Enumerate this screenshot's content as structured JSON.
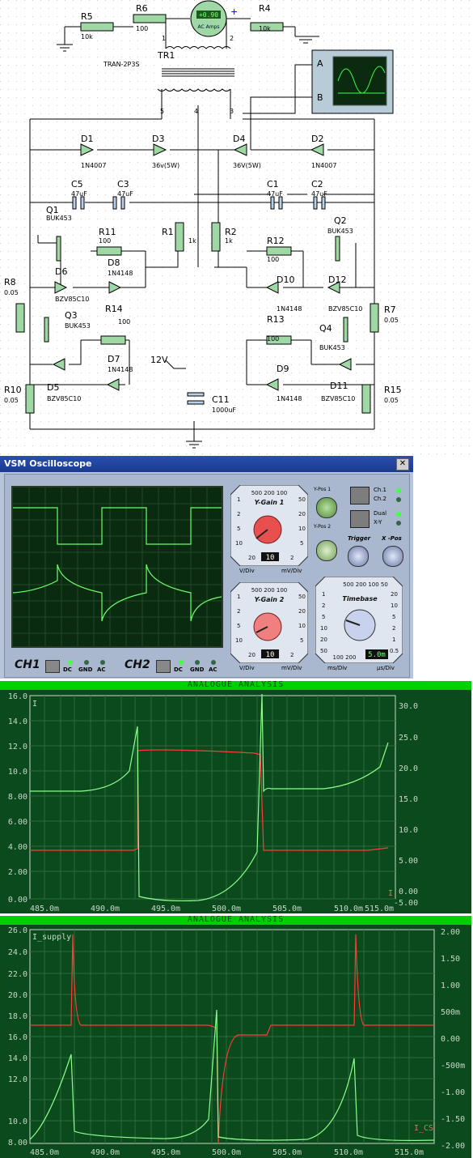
{
  "schematic": {
    "meter_value": "+0.90",
    "meter_unit": "AC Amps",
    "resistors": {
      "r5": {
        "name": "R5",
        "value": "10k"
      },
      "r6": {
        "name": "R6",
        "value": "100"
      },
      "r4": {
        "name": "R4",
        "value": "10k"
      },
      "r11": {
        "name": "R11",
        "value": "100"
      },
      "r12": {
        "name": "R12",
        "value": "100"
      },
      "r13": {
        "name": "R13",
        "value": "100"
      },
      "r14": {
        "name": "R14",
        "value": "100"
      },
      "r1": {
        "name": "R1",
        "value": "1k"
      },
      "r2": {
        "name": "R2",
        "value": "1k"
      },
      "r7": {
        "name": "R7",
        "value": "0.05"
      },
      "r8": {
        "name": "R8",
        "value": "0.05"
      },
      "r10": {
        "name": "R10",
        "value": "0.05"
      },
      "r15": {
        "name": "R15",
        "value": "0.05"
      }
    },
    "transformer": {
      "name": "TR1",
      "model": "TRAN-2P3S",
      "pins": [
        "1",
        "2",
        "3",
        "4",
        "5"
      ]
    },
    "diodes": {
      "d1": {
        "name": "D1",
        "value": "1N4007"
      },
      "d2": {
        "name": "D2",
        "value": "1N4007"
      },
      "d3": {
        "name": "D3",
        "value": "36v(5W)"
      },
      "d4": {
        "name": "D4",
        "value": "36V(5W)"
      },
      "d6": {
        "name": "D6",
        "value": "BZV85C10"
      },
      "d5": {
        "name": "D5",
        "value": "BZV85C10"
      },
      "d8": {
        "name": "D8",
        "value": "1N4148"
      },
      "d7": {
        "name": "D7",
        "value": "1N4148"
      },
      "d10": {
        "name": "D10",
        "value": "1N4148"
      },
      "d9": {
        "name": "D9",
        "value": "1N4148"
      },
      "d12": {
        "name": "D12",
        "value": "BZV85C10"
      },
      "d11": {
        "name": "D11",
        "value": "BZV85C10"
      }
    },
    "caps": {
      "c5": {
        "name": "C5",
        "value": "47uF"
      },
      "c3": {
        "name": "C3",
        "value": "47uF"
      },
      "c1": {
        "name": "C1",
        "value": "47uF"
      },
      "c2": {
        "name": "C2",
        "value": "47uF"
      },
      "c11": {
        "name": "C11",
        "value": "1000uF"
      }
    },
    "fets": {
      "q1": {
        "name": "Q1",
        "value": "BUK453"
      },
      "q2": {
        "name": "Q2",
        "value": "BUK453"
      },
      "q3": {
        "name": "Q3",
        "value": "BUK453"
      },
      "q4": {
        "name": "Q4",
        "value": "BUK453"
      }
    },
    "supply_label": "12V",
    "scope_channels": [
      "A",
      "B"
    ],
    "meter_plus": "+"
  },
  "oscilloscope": {
    "title": "VSM Oscilloscope",
    "close_label": "✕",
    "ch1_label": "CH1",
    "ch2_label": "CH2",
    "coupling": [
      "DC",
      "GND",
      "AC"
    ],
    "ygain1": {
      "title": "Y-Gain 1",
      "top": "500 200 100",
      "left": [
        "1",
        "2",
        "5",
        "10"
      ],
      "right": [
        "50",
        "20",
        "10",
        "5"
      ],
      "bottom_left": "20",
      "bottom_right": "2",
      "value": "10",
      "unit_left": "V/Div",
      "unit_right": "mV/Div"
    },
    "ygain2": {
      "title": "Y-Gain 2",
      "top": "500 200 100",
      "left": [
        "1",
        "2",
        "5",
        "10"
      ],
      "right": [
        "50",
        "20",
        "10",
        "5"
      ],
      "bottom_left": "20",
      "bottom_right": "2",
      "value": "10",
      "unit_left": "V/Div",
      "unit_right": "mV/Div"
    },
    "ypos1": "Y-Pos 1",
    "ypos2": "Y-Pos 2",
    "trigger": "Trigger",
    "xpos": "X -Pos",
    "ch_select": [
      "Ch.1",
      "Ch.2"
    ],
    "mode_select": [
      "Dual",
      "X-Y"
    ],
    "timebase": {
      "title": "Timebase",
      "top": "500 200 100 50",
      "left": [
        "1",
        "2",
        "5",
        "10",
        "20",
        "50"
      ],
      "right": [
        "20",
        "10",
        "5",
        "2",
        "1",
        "0.5"
      ],
      "bottom": "100 200",
      "value": "5.0m",
      "unit_left": "ms/Div",
      "unit_right": "µs/Div"
    }
  },
  "analysis1": {
    "header": "ANALOGUE ANALYSIS",
    "trace_label": "I",
    "left_ticks": [
      "16.0",
      "14.0",
      "12.0",
      "10.0",
      "8.00",
      "6.00",
      "4.00",
      "2.00",
      "0.00"
    ],
    "right_ticks": [
      "30.0",
      "25.0",
      "20.0",
      "15.0",
      "10.0",
      "5.00",
      "0.00",
      "-5.00"
    ],
    "x_ticks": [
      "485.0m",
      "490.0m",
      "495.0m",
      "500.0m",
      "505.0m",
      "510.0m",
      "515.0m"
    ],
    "corner_label": "I"
  },
  "analysis2": {
    "header": "ANALOGUE ANALYSIS",
    "trace_label": "I_supply",
    "left_ticks": [
      "26.0",
      "24.0",
      "22.0",
      "20.0",
      "18.0",
      "16.0",
      "14.0",
      "12.0",
      "10.0",
      "8.00"
    ],
    "right_ticks": [
      "2.00",
      "1.50",
      "1.00",
      "500m",
      "0.00",
      "-500m",
      "-1.00",
      "-1.50",
      "-2.00"
    ],
    "x_ticks": [
      "485.0m",
      "490.0m",
      "495.0m",
      "500.0m",
      "505.0m",
      "510.0m",
      "515.0m"
    ],
    "corner_label": "I_CS"
  }
}
